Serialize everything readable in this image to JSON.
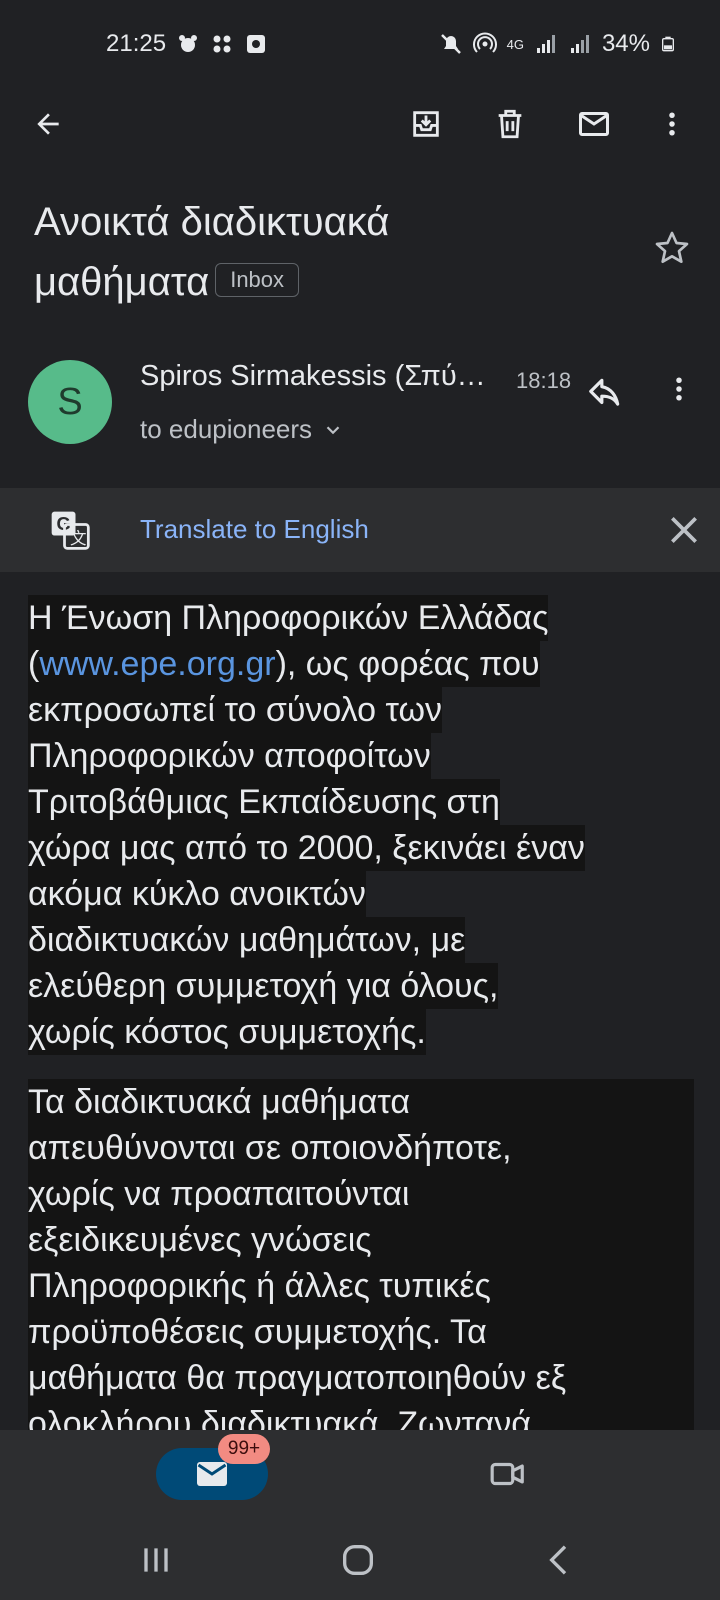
{
  "status_bar": {
    "time": "21:25",
    "battery": "34%",
    "network": "4G",
    "left_icons": [
      "notification-icon",
      "apps-icon",
      "media-icon"
    ],
    "right_icons": [
      "mute-icon",
      "hotspot-icon",
      "data-arrows-icon",
      "signal-icon",
      "signal-icon",
      "battery-charging-icon"
    ]
  },
  "toolbar": {
    "icons": [
      "back-arrow-icon",
      "archive-icon",
      "delete-icon",
      "mark-unread-icon",
      "more-vert-icon"
    ]
  },
  "email": {
    "subject_line1": "Ανοικτά διαδικτυακά",
    "subject_line2": "μαθήματα",
    "label": "Inbox",
    "sender_name": "Spiros Sirmakessis (Σπύ…",
    "time": "18:18",
    "recipient": "to edupioneers"
  },
  "translate": {
    "label": "Translate to English"
  },
  "body": {
    "p1": {
      "line1": "Η Ένωση Πληροφορικών Ελλάδας",
      "line2_open": "(",
      "line2_link": "www.epe.org.gr",
      "line2_rest": "), ως φορέας που",
      "line3": "εκπροσωπεί το σύνολο των",
      "line4": "Πληροφορικών αποφοίτων",
      "line5": "Τριτοβάθμιας Εκπαίδευσης στη",
      "line6": "χώρα μας από το 2000, ξεκινάει έναν",
      "line7": "ακόμα κύκλο ανοικτών",
      "line8": "διαδικτυακών μαθημάτων, με",
      "line9": "ελεύθερη συμμετοχή για όλους,",
      "line10": "χωρίς κόστος συμμετοχής."
    },
    "p2": {
      "line1": "Τα διαδικτυακά μαθήματα",
      "line2": "απευθύνονται σε οποιονδήποτε,",
      "line3": "χωρίς να προαπαιτούνται",
      "line4": "εξειδικευμένες γνώσεις",
      "line5": "Πληροφορικής ή άλλες τυπικές",
      "line6": "προϋποθέσεις συμμετοχής. Τα",
      "line7": "μαθήματα θα πραγματοποιηθούν εξ",
      "line8": "ολοκλήρου διαδικτυακά. Ζωντανά"
    }
  },
  "bottom_nav": {
    "mail_badge": "99+",
    "tabs": [
      "mail-icon",
      "video-icon"
    ]
  },
  "colors": {
    "background": "#202124",
    "link": "#5a95e0",
    "translate_link": "#8ab4f8",
    "avatar": "#57bb8a",
    "badge": "#f28b82",
    "mail_tab": "#004a77"
  }
}
